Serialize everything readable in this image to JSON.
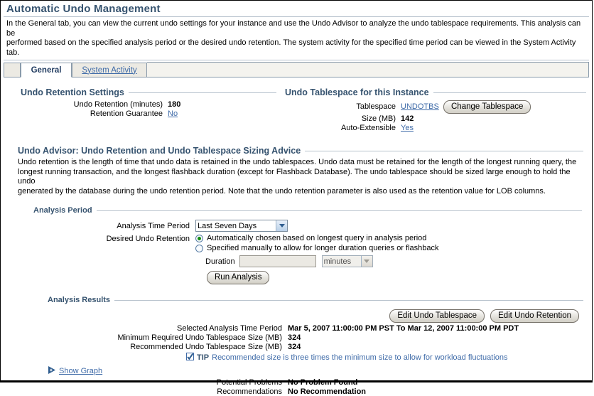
{
  "page": {
    "title": "Automatic Undo Management",
    "intro_line1": "In the General tab, you can view the current undo settings for your instance and use the Undo Advisor to analyze the undo tablespace requirements. This analysis can be",
    "intro_line2": "performed based on the specified analysis period or the desired undo retention. The system activity for the specified time period can be viewed in the System Activity tab."
  },
  "tabs": [
    {
      "label": "General",
      "active": true
    },
    {
      "label": "System Activity",
      "active": false
    }
  ],
  "undo_retention_settings": {
    "heading": "Undo Retention Settings",
    "rows": [
      {
        "label": "Undo Retention (minutes)",
        "value": "180",
        "link": false
      },
      {
        "label": "Retention Guarantee",
        "value": "No",
        "link": true
      }
    ]
  },
  "undo_tablespace": {
    "heading": "Undo Tablespace for this Instance",
    "rows": [
      {
        "label": "Tablespace",
        "value": "UNDOTBS",
        "link": true
      },
      {
        "label": "Size (MB)",
        "value": "142",
        "link": false
      },
      {
        "label": "Auto-Extensible",
        "value": "Yes",
        "link": true
      }
    ],
    "change_button": "Change Tablespace"
  },
  "advisor": {
    "heading": "Undo Advisor: Undo Retention and Undo Tablespace Sizing Advice",
    "line1": "Undo retention is the length of time that undo data is retained in the undo tablespaces. Undo data must be retained for the length of the longest running query, the",
    "line2": "longest running transaction, and the longest flashback duration (except for Flashback Database). The undo tablespace should be sized large enough to hold the undo",
    "line3": "generated by the database during the undo retention period. Note that the undo retention parameter is also used as the retention value for LOB columns."
  },
  "analysis_period": {
    "heading": "Analysis Period",
    "time_period_label": "Analysis Time Period",
    "time_period_value": "Last Seven Days",
    "time_period_options": [
      "Last Seven Days"
    ],
    "desired_retention_label": "Desired Undo Retention",
    "radio_auto_label": "Automatically chosen based on longest query in analysis period",
    "radio_manual_label": "Specified manually to allow for longer duration queries or flashback",
    "duration_label": "Duration",
    "duration_value": "",
    "duration_placeholder": "",
    "duration_unit_value": "minutes",
    "duration_unit_options": [
      "minutes"
    ],
    "run_button": "Run Analysis"
  },
  "analysis_results": {
    "heading": "Analysis Results",
    "edit_tablespace_button": "Edit Undo Tablespace",
    "edit_retention_button": "Edit Undo Retention",
    "rows": [
      {
        "label": "Selected Analysis Time Period",
        "value": "Mar 5, 2007 11:00:00 PM PST To Mar 12, 2007 11:00:00 PM PDT"
      },
      {
        "label": "Minimum Required Undo Tablespace Size (MB)",
        "value": "324"
      },
      {
        "label": "Recommended Undo Tablespace Size (MB)",
        "value": "324"
      }
    ],
    "tip_word": "TIP",
    "tip_text": "Recommended size is three times the minimum size to allow for workload fluctuations",
    "problem_rows": [
      {
        "label": "Potential Problems",
        "value": "No Problem Found"
      },
      {
        "label": "Recommendations",
        "value": "No Recommendation"
      }
    ]
  },
  "show_graph": {
    "label": "Show Graph"
  },
  "colors": {
    "heading_blue": "#36536f",
    "link_blue": "#3f6ba8",
    "rule_gray": "#b7c2cd",
    "radio_green": "#118a11"
  }
}
